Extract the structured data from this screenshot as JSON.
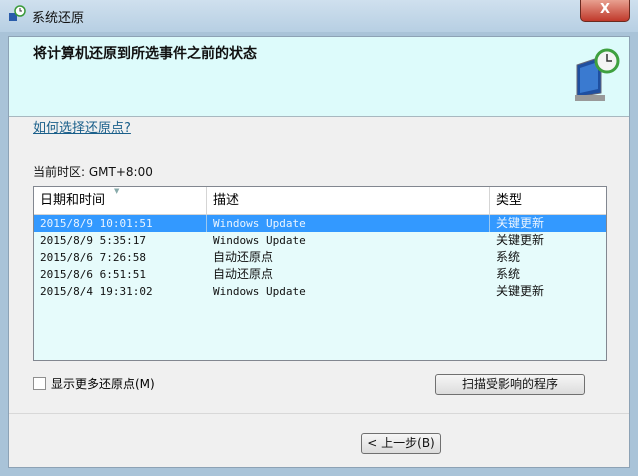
{
  "window": {
    "title": "系统还原",
    "close_label": "X"
  },
  "header": {
    "title": "将计算机还原到所选事件之前的状态"
  },
  "help_link": "如何选择还原点?",
  "timezone": "当前时区: GMT+8:00",
  "table": {
    "columns": [
      "日期和时间",
      "描述",
      "类型"
    ],
    "rows": [
      {
        "date": "2015/8/9 10:01:51",
        "desc": "Windows Update",
        "type": "关键更新",
        "selected": true
      },
      {
        "date": "2015/8/9 5:35:17",
        "desc": "Windows Update",
        "type": "关键更新"
      },
      {
        "date": "2015/8/6 7:26:58",
        "desc": "自动还原点",
        "type": "系统"
      },
      {
        "date": "2015/8/6 6:51:51",
        "desc": "自动还原点",
        "type": "系统"
      },
      {
        "date": "2015/8/4 19:31:02",
        "desc": "Windows Update",
        "type": "关键更新"
      }
    ]
  },
  "show_more_label": "显示更多还原点(M)",
  "scan_button": "扫描受影响的程序",
  "back_button": "< 上一步(B)"
}
